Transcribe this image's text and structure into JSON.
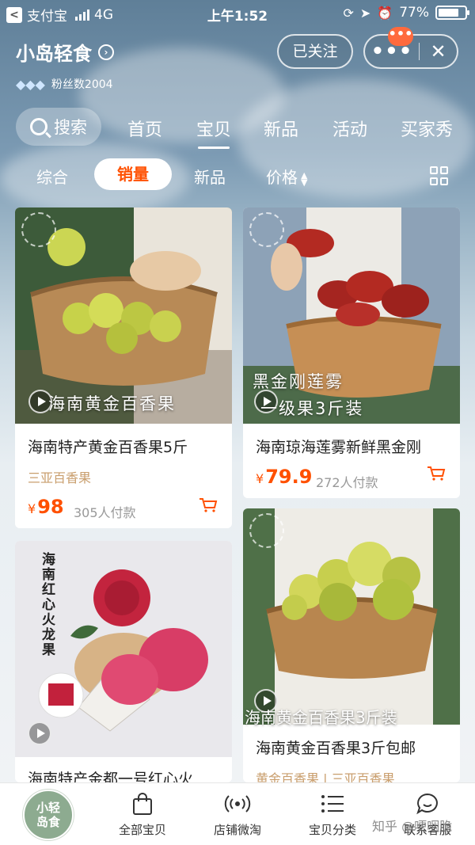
{
  "statusbar": {
    "app": "支付宝",
    "network": "4G",
    "time": "上午1:52",
    "battery": "77%",
    "battery_level": 0.77
  },
  "shop": {
    "name": "小岛轻食",
    "fans": "粉丝数2004",
    "follow_label": "已关注",
    "more_label": "•••",
    "close_label": "✕",
    "badge": "•••"
  },
  "nav": {
    "search": "搜索",
    "tabs": [
      "首页",
      "宝贝",
      "新品",
      "活动",
      "买家秀"
    ],
    "active": "宝贝"
  },
  "sort": {
    "items": [
      "综合",
      "销量",
      "新品",
      "价格"
    ],
    "active": "销量"
  },
  "products": [
    {
      "title": "海南特产黄金百香果5斤",
      "tag": "三亚百香果",
      "currency": "¥",
      "price": "98",
      "paid": "305人付款",
      "overlay": "海南黄金百香果"
    },
    {
      "title": "海南琼海莲雾新鲜黑金刚",
      "tag": "",
      "currency": "¥",
      "price": "79.9",
      "paid": "272人付款",
      "overlay_line1": "黑金刚莲雾",
      "overlay_line2": "一级果3斤装"
    },
    {
      "title": "海南特产金都一号红心火",
      "vertical_text": "海南红心火龙果"
    },
    {
      "title": "海南黄金百香果3斤包邮",
      "tag": "黄金百香果 | 三亚百香果",
      "overlay": "海南黄金百香果3斤装"
    }
  ],
  "bottombar": {
    "logo": "小轻岛食",
    "items": [
      "全部宝贝",
      "店铺微淘",
      "宝贝分类",
      "联系客服"
    ]
  },
  "watermark": "知乎 @哽咽脆",
  "colors": {
    "accent": "#ff5000",
    "tag": "#c99e6d",
    "logo_green": "#8dab90"
  }
}
